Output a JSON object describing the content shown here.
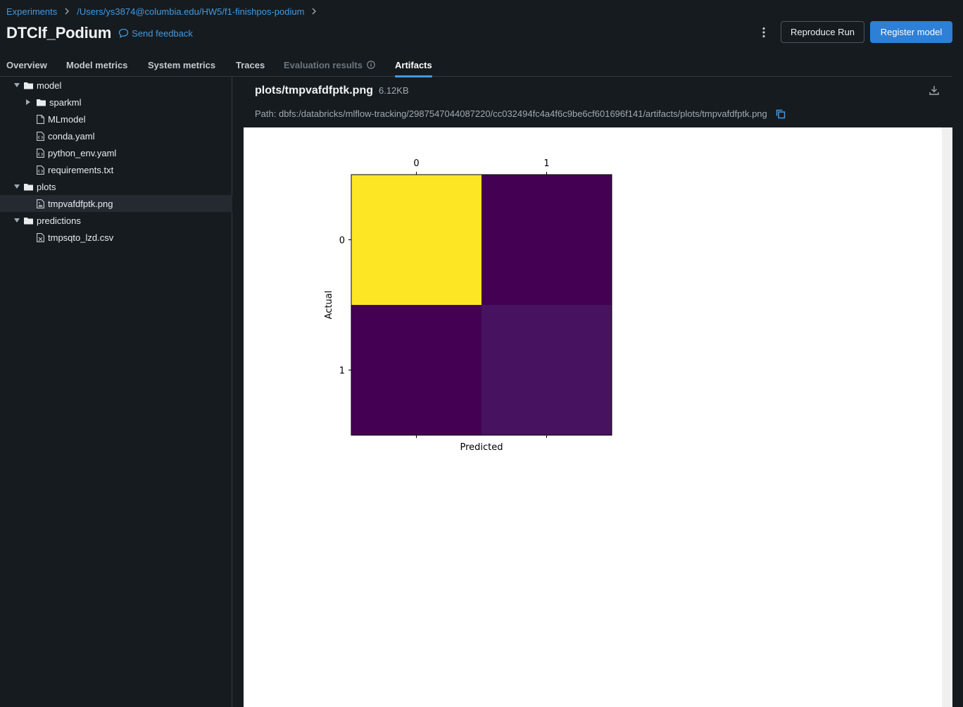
{
  "breadcrumb": {
    "experiments": "Experiments",
    "path": "/Users/ys3874@columbia.edu/HW5/f1-finishpos-podium"
  },
  "header": {
    "title": "DTClf_Podium",
    "feedback": "Send feedback",
    "reproduce": "Reproduce Run",
    "register": "Register model"
  },
  "tabs": [
    {
      "label": "Overview"
    },
    {
      "label": "Model metrics"
    },
    {
      "label": "System metrics"
    },
    {
      "label": "Traces"
    },
    {
      "label": "Evaluation results"
    },
    {
      "label": "Artifacts"
    }
  ],
  "tree": [
    {
      "label": "model",
      "icon": "folder-icon"
    },
    {
      "label": "sparkml",
      "icon": "folder-icon"
    },
    {
      "label": "MLmodel",
      "icon": "file-icon"
    },
    {
      "label": "conda.yaml",
      "icon": "code-file-icon"
    },
    {
      "label": "python_env.yaml",
      "icon": "code-file-icon"
    },
    {
      "label": "requirements.txt",
      "icon": "code-file-icon"
    },
    {
      "label": "plots",
      "icon": "folder-icon"
    },
    {
      "label": "tmpvafdfptk.png",
      "icon": "image-file-icon"
    },
    {
      "label": "predictions",
      "icon": "folder-icon"
    },
    {
      "label": "tmpsqto_lzd.csv",
      "icon": "spreadsheet-file-icon"
    }
  ],
  "file": {
    "name": "plots/tmpvafdfptk.png",
    "size": "6.12KB",
    "path": "Path: dbfs:/databricks/mlflow-tracking/2987547044087220/cc032494fc4a4f6c9be6cf601696f141/artifacts/plots/tmpvafdfptk.png"
  },
  "chart_data": {
    "type": "heatmap",
    "x_categories": [
      "0",
      "1"
    ],
    "y_categories": [
      "0",
      "1"
    ],
    "xlabel": "Predicted",
    "ylabel": "Actual",
    "values": [
      [
        1.0,
        0.0
      ],
      [
        0.0,
        0.04
      ]
    ],
    "colors": [
      [
        "#fde725",
        "#440154"
      ],
      [
        "#440154",
        "#47125f"
      ]
    ],
    "colormap": "viridis"
  },
  "colors": {
    "accent": "#4299e0",
    "primary_button": "#2e7fd6",
    "background": "#161b1f"
  }
}
